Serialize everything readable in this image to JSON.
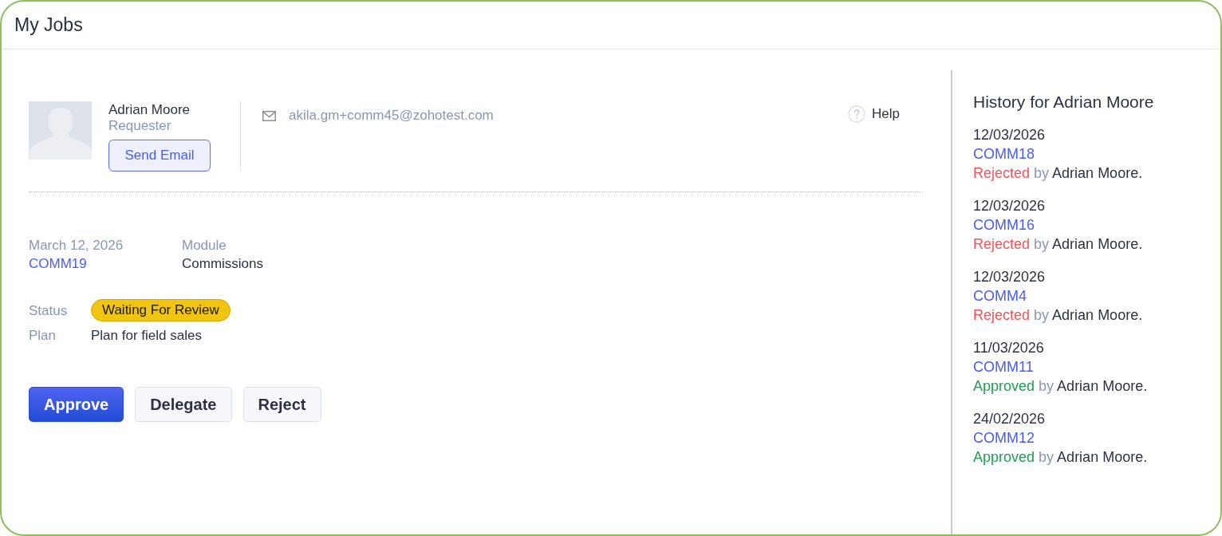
{
  "window": {
    "title": "My Jobs"
  },
  "requester": {
    "name": "Adrian Moore",
    "role": "Requester",
    "send_button": "Send Email",
    "email": "akila.gm+comm45@zohotest.com"
  },
  "help": {
    "label": "Help"
  },
  "job": {
    "date": "March 12, 2026",
    "id": "COMM19",
    "module_label": "Module",
    "module": "Commissions",
    "status_label": "Status",
    "status": "Waiting For Review",
    "plan_label": "Plan",
    "plan": "Plan for field sales"
  },
  "actions": [
    {
      "label": "Approve",
      "kind": "primary"
    },
    {
      "label": "Delegate",
      "kind": "secondary"
    },
    {
      "label": "Reject",
      "kind": "secondary"
    }
  ],
  "history": {
    "title": "History for Adrian Moore",
    "entries": [
      {
        "date": "12/03/2026",
        "id": "COMM18",
        "kind": "rejected",
        "outcome": "Rejected",
        "connector": "by",
        "actor": "Adrian Moore."
      },
      {
        "date": "12/03/2026",
        "id": "COMM16",
        "kind": "rejected",
        "outcome": "Rejected",
        "connector": "by",
        "actor": "Adrian Moore."
      },
      {
        "date": "12/03/2026",
        "id": "COMM4",
        "kind": "rejected",
        "outcome": "Rejected",
        "connector": "by",
        "actor": "Adrian Moore."
      },
      {
        "date": "11/03/2026",
        "id": "COMM11",
        "kind": "approved",
        "outcome": "Approved",
        "connector": "by",
        "actor": "Adrian Moore."
      },
      {
        "date": "24/02/2026",
        "id": "COMM12",
        "kind": "approved",
        "outcome": "Approved",
        "connector": "by",
        "actor": "Adrian Moore."
      }
    ]
  }
}
